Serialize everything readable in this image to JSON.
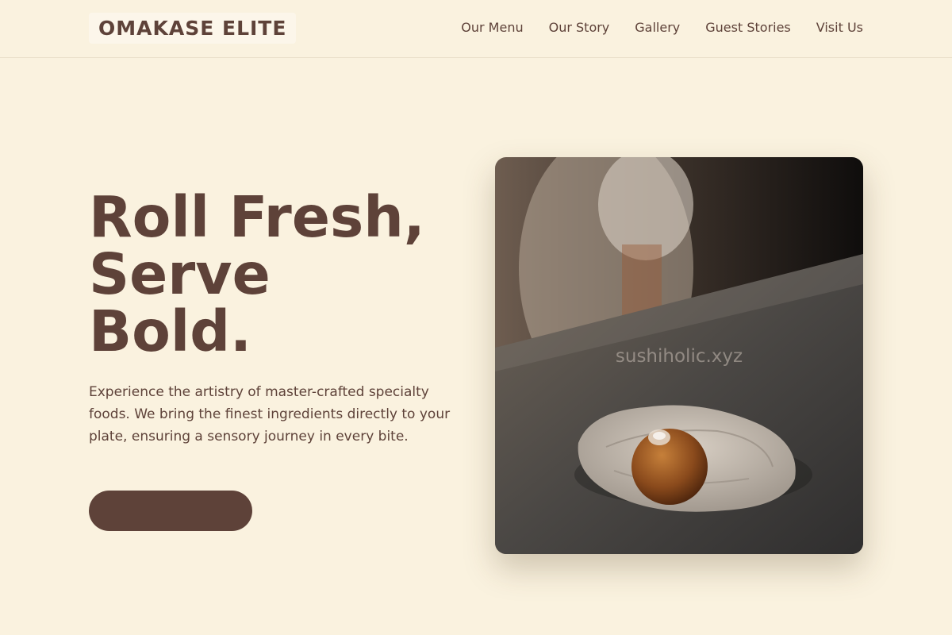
{
  "header": {
    "logo": "OMAKASE ELITE",
    "nav": [
      "Our Menu",
      "Our Story",
      "Gallery",
      "Guest Stories",
      "Visit Us"
    ]
  },
  "hero": {
    "title_lines": [
      "Roll Fresh,",
      "Serve",
      "Bold."
    ],
    "description": "Experience the artistry of master-crafted specialty foods. We bring the finest ingredients directly to your plate, ensuring a sensory journey in every bite.",
    "cta_label": "",
    "image_watermark": "sushiholic.xyz"
  },
  "colors": {
    "background": "#faf2df",
    "text": "#5e4239",
    "accent": "#5e4239"
  }
}
